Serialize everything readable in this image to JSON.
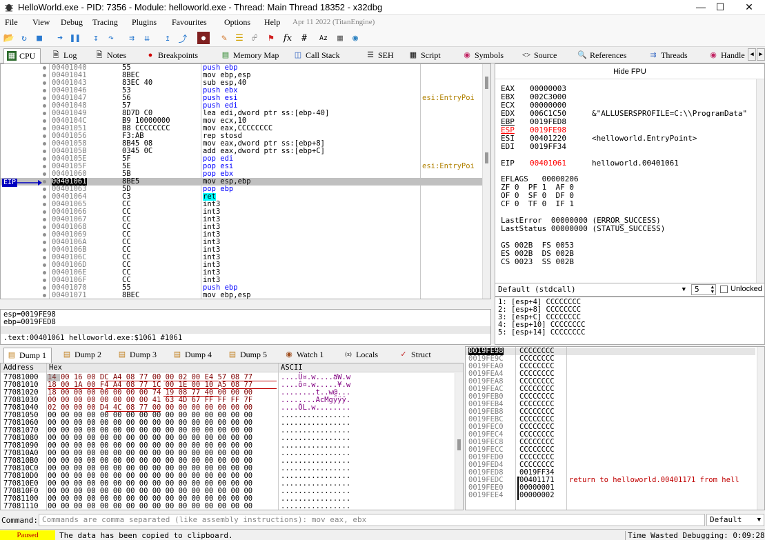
{
  "window": {
    "title": "HelloWorld.exe - PID: 7356 - Module: helloworld.exe - Thread: Main Thread 18352 - x32dbg"
  },
  "menu": [
    "File",
    "View",
    "Debug",
    "Tracing",
    "Plugins",
    "Favourites",
    "Options",
    "Help"
  ],
  "menu_date": "Apr 11 2022 (TitanEngine)",
  "toolbar_icons": [
    "open-icon",
    "restart-icon",
    "stop-icon",
    "run-icon",
    "pause-icon",
    "step-into-icon",
    "step-over-icon",
    "trace-into-icon",
    "trace-over-icon",
    "execute-till-return-icon",
    "run-to-user-code-icon",
    "hardware-icon",
    "patch-icon",
    "comment-icon",
    "label-icon",
    "bookmark-icon",
    "function-icon",
    "hash-icon",
    "strings-icon",
    "script-icon",
    "globe-icon"
  ],
  "tabs": [
    {
      "label": "CPU",
      "icon": "cpu-icon"
    },
    {
      "label": "Log",
      "icon": "log-icon"
    },
    {
      "label": "Notes",
      "icon": "notes-icon"
    },
    {
      "label": "Breakpoints",
      "icon": "breakpoint-icon"
    },
    {
      "label": "Memory Map",
      "icon": "memory-icon"
    },
    {
      "label": "Call Stack",
      "icon": "callstack-icon"
    },
    {
      "label": "SEH",
      "icon": "seh-icon"
    },
    {
      "label": "Script",
      "icon": "script-icon"
    },
    {
      "label": "Symbols",
      "icon": "symbols-icon"
    },
    {
      "label": "Source",
      "icon": "source-icon"
    },
    {
      "label": "References",
      "icon": "references-icon"
    },
    {
      "label": "Threads",
      "icon": "threads-icon"
    },
    {
      "label": "Handle",
      "icon": "handle-icon"
    }
  ],
  "disasm": {
    "eip_label": "EIP",
    "rows": [
      {
        "addr": "00401040",
        "bytes": "55",
        "instr": "push ebp",
        "cmt": ""
      },
      {
        "addr": "00401041",
        "bytes": "8BEC",
        "instr": "mov ebp,esp",
        "cmt": ""
      },
      {
        "addr": "00401043",
        "bytes": "83EC 40",
        "instr": "sub esp,40",
        "cmt": ""
      },
      {
        "addr": "00401046",
        "bytes": "53",
        "instr": "push ebx",
        "cmt": ""
      },
      {
        "addr": "00401047",
        "bytes": "56",
        "instr": "push esi",
        "cmt": "esi:EntryPoi"
      },
      {
        "addr": "00401048",
        "bytes": "57",
        "instr": "push edi",
        "cmt": ""
      },
      {
        "addr": "00401049",
        "bytes": "8D7D C0",
        "instr": "lea edi,dword ptr ss:[ebp-40]",
        "cmt": ""
      },
      {
        "addr": "0040104C",
        "bytes": "B9 10000000",
        "instr": "mov ecx,10",
        "cmt": ""
      },
      {
        "addr": "00401051",
        "bytes": "B8 CCCCCCCC",
        "instr": "mov eax,CCCCCCCC",
        "cmt": ""
      },
      {
        "addr": "00401056",
        "bytes": "F3:AB",
        "instr": "rep stosd",
        "cmt": ""
      },
      {
        "addr": "00401058",
        "bytes": "8B45 08",
        "instr": "mov eax,dword ptr ss:[ebp+8]",
        "cmt": ""
      },
      {
        "addr": "0040105B",
        "bytes": "0345 0C",
        "instr": "add eax,dword ptr ss:[ebp+C]",
        "cmt": ""
      },
      {
        "addr": "0040105E",
        "bytes": "5F",
        "instr": "pop edi",
        "cmt": ""
      },
      {
        "addr": "0040105F",
        "bytes": "5E",
        "instr": "pop esi",
        "cmt": "esi:EntryPoi"
      },
      {
        "addr": "00401060",
        "bytes": "5B",
        "instr": "pop ebx",
        "cmt": ""
      },
      {
        "addr": "00401061",
        "bytes": "8BE5",
        "instr": "mov esp,ebp",
        "cmt": ""
      },
      {
        "addr": "00401063",
        "bytes": "5D",
        "instr": "pop ebp",
        "cmt": ""
      },
      {
        "addr": "00401064",
        "bytes": "C3",
        "instr": "ret",
        "cmt": ""
      },
      {
        "addr": "00401065",
        "bytes": "CC",
        "instr": "int3",
        "cmt": ""
      },
      {
        "addr": "00401066",
        "bytes": "CC",
        "instr": "int3",
        "cmt": ""
      },
      {
        "addr": "00401067",
        "bytes": "CC",
        "instr": "int3",
        "cmt": ""
      },
      {
        "addr": "00401068",
        "bytes": "CC",
        "instr": "int3",
        "cmt": ""
      },
      {
        "addr": "00401069",
        "bytes": "CC",
        "instr": "int3",
        "cmt": ""
      },
      {
        "addr": "0040106A",
        "bytes": "CC",
        "instr": "int3",
        "cmt": ""
      },
      {
        "addr": "0040106B",
        "bytes": "CC",
        "instr": "int3",
        "cmt": ""
      },
      {
        "addr": "0040106C",
        "bytes": "CC",
        "instr": "int3",
        "cmt": ""
      },
      {
        "addr": "0040106D",
        "bytes": "CC",
        "instr": "int3",
        "cmt": ""
      },
      {
        "addr": "0040106E",
        "bytes": "CC",
        "instr": "int3",
        "cmt": ""
      },
      {
        "addr": "0040106F",
        "bytes": "CC",
        "instr": "int3",
        "cmt": ""
      },
      {
        "addr": "00401070",
        "bytes": "55",
        "instr": "push ebp",
        "cmt": ""
      },
      {
        "addr": "00401071",
        "bytes": "8BEC",
        "instr": "mov ebp,esp",
        "cmt": ""
      }
    ]
  },
  "registers": {
    "hide_fpu": "Hide FPU",
    "lines": [
      {
        "name": "EAX",
        "value": "00000003",
        "note": "",
        "changed": false
      },
      {
        "name": "EBX",
        "value": "002C3000",
        "note": "",
        "changed": false
      },
      {
        "name": "ECX",
        "value": "00000000",
        "note": "",
        "changed": false
      },
      {
        "name": "EDX",
        "value": "006C1C50",
        "note": "&\"ALLUSERSPROFILE=C:\\\\ProgramData\"",
        "changed": false
      },
      {
        "name": "EBP",
        "value": "0019FED8",
        "note": "",
        "changed": false
      },
      {
        "name": "ESP",
        "value": "0019FE98",
        "note": "",
        "changed": true
      },
      {
        "name": "ESI",
        "value": "00401220",
        "note": "<helloworld.EntryPoint>",
        "changed": false
      },
      {
        "name": "EDI",
        "value": "0019FF34",
        "note": "",
        "changed": false
      },
      {
        "name": "EIP",
        "value": "00401061",
        "note": "helloworld.00401061",
        "changed": true
      }
    ],
    "eflags": "EFLAGS   00000206",
    "flags": [
      "ZF 0  PF 1  AF 0",
      "OF 0  SF 0  DF 0",
      "CF 0  TF 0  IF 1"
    ],
    "lasterror": "LastError  00000000 (ERROR_SUCCESS)",
    "laststatus": "LastStatus 00000000 (STATUS_SUCCESS)",
    "segs": [
      "GS 002B  FS 0053",
      "ES 002B  DS 002B",
      "CS 0023  SS 002B"
    ]
  },
  "callconv": {
    "selected": "Default (stdcall)",
    "count": "5",
    "unlocked": "Unlocked"
  },
  "args": [
    "1: [esp+4] CCCCCCCC",
    "2: [esp+8] CCCCCCCC",
    "3: [esp+C] CCCCCCCC",
    "4: [esp+10] CCCCCCCC",
    "5: [esp+14] CCCCCCCC"
  ],
  "info": {
    "line1": "esp=0019FE98",
    "line2": "ebp=0019FED8",
    "line3": ".text:00401061 helloworld.exe:$1061 #1061"
  },
  "dump_tabs": [
    {
      "label": "Dump 1",
      "icon": "dump-icon"
    },
    {
      "label": "Dump 2",
      "icon": "dump-icon"
    },
    {
      "label": "Dump 3",
      "icon": "dump-icon"
    },
    {
      "label": "Dump 4",
      "icon": "dump-icon"
    },
    {
      "label": "Dump 5",
      "icon": "dump-icon"
    },
    {
      "label": "Watch 1",
      "icon": "watch-icon"
    },
    {
      "label": "Locals",
      "icon": "locals-icon"
    },
    {
      "label": "Struct",
      "icon": "struct-icon"
    }
  ],
  "dump": {
    "headers": [
      "Address",
      "Hex",
      "ASCII"
    ],
    "rows": [
      {
        "addr": "77081000",
        "hex": "14 00 16 00 DC A4 08 77 00 00 02 00 E4 57 08 77",
        "ascii": "....Ü¤.w....äW.w"
      },
      {
        "addr": "77081010",
        "hex": "18 00 1A 00 F4 A4 08 77 1C 00 1E 00 10 A5 08 77",
        "ascii": "....ô¤.w.....¥.w"
      },
      {
        "addr": "77081020",
        "hex": "18 00 00 00 00 00 00 00 74 19 08 77 40 00 00 00",
        "ascii": "........t..w@..."
      },
      {
        "addr": "77081030",
        "hex": "00 00 00 00 00 00 00 00 41 63 4D 67 FF FF FF 7F",
        "ascii": "........AcMgÿÿÿ."
      },
      {
        "addr": "77081040",
        "hex": "02 00 00 00 D4 4C 08 77 00 00 00 00 00 00 00 00",
        "ascii": "....ÔL.w........"
      },
      {
        "addr": "77081050",
        "hex": "00 00 00 00 00 00 00 00 00 00 00 00 00 00 00 00",
        "ascii": "................"
      },
      {
        "addr": "77081060",
        "hex": "00 00 00 00 00 00 00 00 00 00 00 00 00 00 00 00",
        "ascii": "................"
      },
      {
        "addr": "77081070",
        "hex": "00 00 00 00 00 00 00 00 00 00 00 00 00 00 00 00",
        "ascii": "................"
      },
      {
        "addr": "77081080",
        "hex": "00 00 00 00 00 00 00 00 00 00 00 00 00 00 00 00",
        "ascii": "................"
      },
      {
        "addr": "77081090",
        "hex": "00 00 00 00 00 00 00 00 00 00 00 00 00 00 00 00",
        "ascii": "................"
      },
      {
        "addr": "770810A0",
        "hex": "00 00 00 00 00 00 00 00 00 00 00 00 00 00 00 00",
        "ascii": "................"
      },
      {
        "addr": "770810B0",
        "hex": "00 00 00 00 00 00 00 00 00 00 00 00 00 00 00 00",
        "ascii": "................"
      },
      {
        "addr": "770810C0",
        "hex": "00 00 00 00 00 00 00 00 00 00 00 00 00 00 00 00",
        "ascii": "................"
      },
      {
        "addr": "770810D0",
        "hex": "00 00 00 00 00 00 00 00 00 00 00 00 00 00 00 00",
        "ascii": "................"
      },
      {
        "addr": "770810E0",
        "hex": "00 00 00 00 00 00 00 00 00 00 00 00 00 00 00 00",
        "ascii": "................"
      },
      {
        "addr": "770810F0",
        "hex": "00 00 00 00 00 00 00 00 00 00 00 00 00 00 00 00",
        "ascii": "................"
      },
      {
        "addr": "77081100",
        "hex": "00 00 00 00 00 00 00 00 00 00 00 00 00 00 00 00",
        "ascii": "................"
      },
      {
        "addr": "77081110",
        "hex": "00 00 00 00 00 00 00 00 00 00 00 00 00 00 00 00",
        "ascii": "................"
      }
    ]
  },
  "stack": {
    "rows": [
      {
        "addr": "0019FE98",
        "val": "CCCCCCCC",
        "cmt": ""
      },
      {
        "addr": "0019FE9C",
        "val": "CCCCCCCC",
        "cmt": ""
      },
      {
        "addr": "0019FEA0",
        "val": "CCCCCCCC",
        "cmt": ""
      },
      {
        "addr": "0019FEA4",
        "val": "CCCCCCCC",
        "cmt": ""
      },
      {
        "addr": "0019FEA8",
        "val": "CCCCCCCC",
        "cmt": ""
      },
      {
        "addr": "0019FEAC",
        "val": "CCCCCCCC",
        "cmt": ""
      },
      {
        "addr": "0019FEB0",
        "val": "CCCCCCCC",
        "cmt": ""
      },
      {
        "addr": "0019FEB4",
        "val": "CCCCCCCC",
        "cmt": ""
      },
      {
        "addr": "0019FEB8",
        "val": "CCCCCCCC",
        "cmt": ""
      },
      {
        "addr": "0019FEBC",
        "val": "CCCCCCCC",
        "cmt": ""
      },
      {
        "addr": "0019FEC0",
        "val": "CCCCCCCC",
        "cmt": ""
      },
      {
        "addr": "0019FEC4",
        "val": "CCCCCCCC",
        "cmt": ""
      },
      {
        "addr": "0019FEC8",
        "val": "CCCCCCCC",
        "cmt": ""
      },
      {
        "addr": "0019FECC",
        "val": "CCCCCCCC",
        "cmt": ""
      },
      {
        "addr": "0019FED0",
        "val": "CCCCCCCC",
        "cmt": ""
      },
      {
        "addr": "0019FED4",
        "val": "CCCCCCCC",
        "cmt": ""
      },
      {
        "addr": "0019FED8",
        "val": "0019FF34",
        "cmt": ""
      },
      {
        "addr": "0019FEDC",
        "val": "00401171",
        "cmt": "return to helloworld.00401171 from hell"
      },
      {
        "addr": "0019FEE0",
        "val": "00000001",
        "cmt": ""
      },
      {
        "addr": "0019FEE4",
        "val": "00000002",
        "cmt": ""
      }
    ]
  },
  "command": {
    "label": "Command:",
    "placeholder": "Commands are comma separated (like assembly instructions): mov eax, ebx",
    "mode": "Default"
  },
  "status": {
    "state": "Paused",
    "message": "The data has been copied to clipboard.",
    "time": "Time Wasted Debugging: 0:09:28:53"
  },
  "colors": {
    "accent": "#0000ff",
    "changed": "#ff0000",
    "eip_bg": "#c0c0c0",
    "paused": "#ffff00"
  }
}
